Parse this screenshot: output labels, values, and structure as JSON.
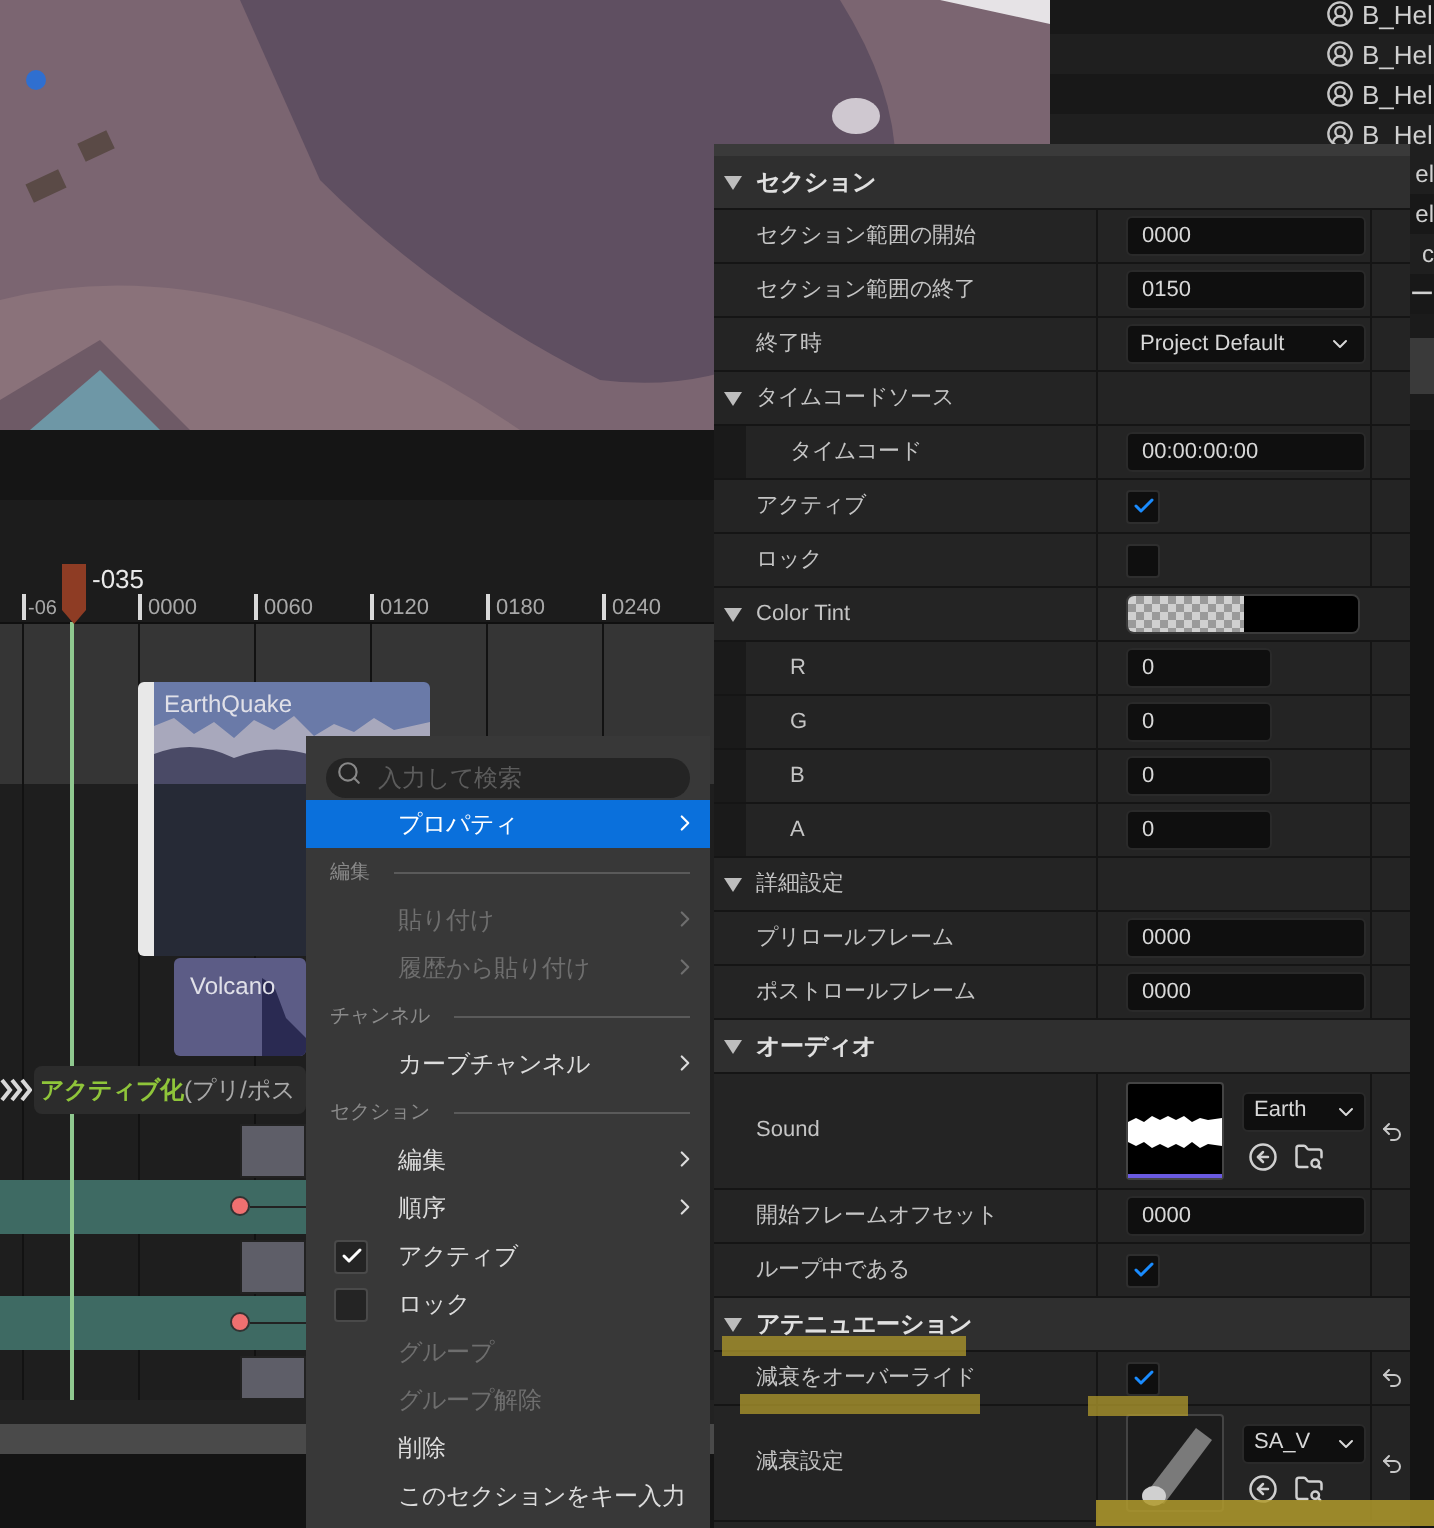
{
  "outliner": {
    "items": [
      {
        "label": "B_Hel"
      },
      {
        "label": "B_Hel"
      },
      {
        "label": "B_Hel"
      },
      {
        "label": "B_Hel"
      }
    ],
    "fragments": [
      "el",
      "el",
      "c",
      "ー"
    ]
  },
  "timeline": {
    "playhead": "-035",
    "ticks": [
      "-06",
      "0000",
      "0060",
      "0120",
      "0180",
      "0240"
    ],
    "clips": [
      {
        "name": "EarthQuake",
        "kind": "audio"
      },
      {
        "name": "Volcano",
        "kind": "audio"
      }
    ],
    "track": {
      "name": "アクティブ化",
      "suffix": "(プリ/ポス"
    }
  },
  "context_menu": {
    "placeholder": "入力して検索",
    "items": [
      {
        "kind": "item",
        "label": "プロパティ",
        "selected": true,
        "disabled": false,
        "submenu": true
      },
      {
        "kind": "heading",
        "label": "編集"
      },
      {
        "kind": "item",
        "label": "貼り付け",
        "selected": false,
        "disabled": true,
        "submenu": true
      },
      {
        "kind": "item",
        "label": "履歴から貼り付け",
        "selected": false,
        "disabled": true,
        "submenu": true
      },
      {
        "kind": "heading",
        "label": "チャンネル"
      },
      {
        "kind": "item",
        "label": "カーブチャンネル",
        "selected": false,
        "disabled": false,
        "submenu": true
      },
      {
        "kind": "heading",
        "label": "セクション"
      },
      {
        "kind": "item",
        "label": "編集",
        "selected": false,
        "disabled": false,
        "submenu": true
      },
      {
        "kind": "item",
        "label": "順序",
        "selected": false,
        "disabled": false,
        "submenu": true
      },
      {
        "kind": "check",
        "label": "アクティブ",
        "selected": false,
        "checked": true
      },
      {
        "kind": "check",
        "label": "ロック",
        "selected": false,
        "checked": false
      },
      {
        "kind": "item",
        "label": "グループ",
        "selected": false,
        "disabled": true,
        "submenu": false
      },
      {
        "kind": "item",
        "label": "グループ解除",
        "selected": false,
        "disabled": true,
        "submenu": false
      },
      {
        "kind": "item",
        "label": "削除",
        "selected": false,
        "disabled": false,
        "submenu": false
      },
      {
        "kind": "item",
        "label": "このセクションをキー入力",
        "selected": false,
        "disabled": false,
        "submenu": false
      }
    ]
  },
  "details": {
    "rows": [
      {
        "kind": "header",
        "label": "セクション",
        "expanded": true
      },
      {
        "kind": "text",
        "label": "セクション範囲の開始",
        "value": "0000",
        "indent": false
      },
      {
        "kind": "text",
        "label": "セクション範囲の終了",
        "value": "0150",
        "indent": false
      },
      {
        "kind": "dropdown",
        "label": "終了時",
        "value": "Project Default",
        "indent": false
      },
      {
        "kind": "group",
        "label": "タイムコードソース",
        "expanded": true
      },
      {
        "kind": "text",
        "label": "タイムコード",
        "value": "00:00:00:00",
        "indent": true
      },
      {
        "kind": "check",
        "label": "アクティブ",
        "checked": true,
        "reset": false
      },
      {
        "kind": "check",
        "label": "ロック",
        "checked": false,
        "reset": false
      },
      {
        "kind": "color",
        "label": "Color Tint",
        "expanded": true
      },
      {
        "kind": "short",
        "label": "R",
        "value": "0",
        "indent": true
      },
      {
        "kind": "short",
        "label": "G",
        "value": "0",
        "indent": true
      },
      {
        "kind": "short",
        "label": "B",
        "value": "0",
        "indent": true
      },
      {
        "kind": "short",
        "label": "A",
        "value": "0",
        "indent": true
      },
      {
        "kind": "group",
        "label": "詳細設定",
        "expanded": true
      },
      {
        "kind": "text",
        "label": "プリロールフレーム",
        "value": "0000",
        "indent": false
      },
      {
        "kind": "text",
        "label": "ポストロールフレーム",
        "value": "0000",
        "indent": false
      },
      {
        "kind": "header",
        "label": "オーディオ",
        "expanded": true
      },
      {
        "kind": "sound",
        "label": "Sound",
        "value": "Earth"
      },
      {
        "kind": "text",
        "label": "開始フレームオフセット",
        "value": "0000",
        "indent": false
      },
      {
        "kind": "check",
        "label": "ループ中である",
        "checked": true,
        "reset": false
      },
      {
        "kind": "header",
        "label": "アテニュエーション",
        "expanded": true
      },
      {
        "kind": "check",
        "label": "減衰をオーバーライド",
        "checked": true,
        "reset": true
      },
      {
        "kind": "attenuation",
        "label": "減衰設定",
        "value": "SA_V"
      }
    ]
  }
}
